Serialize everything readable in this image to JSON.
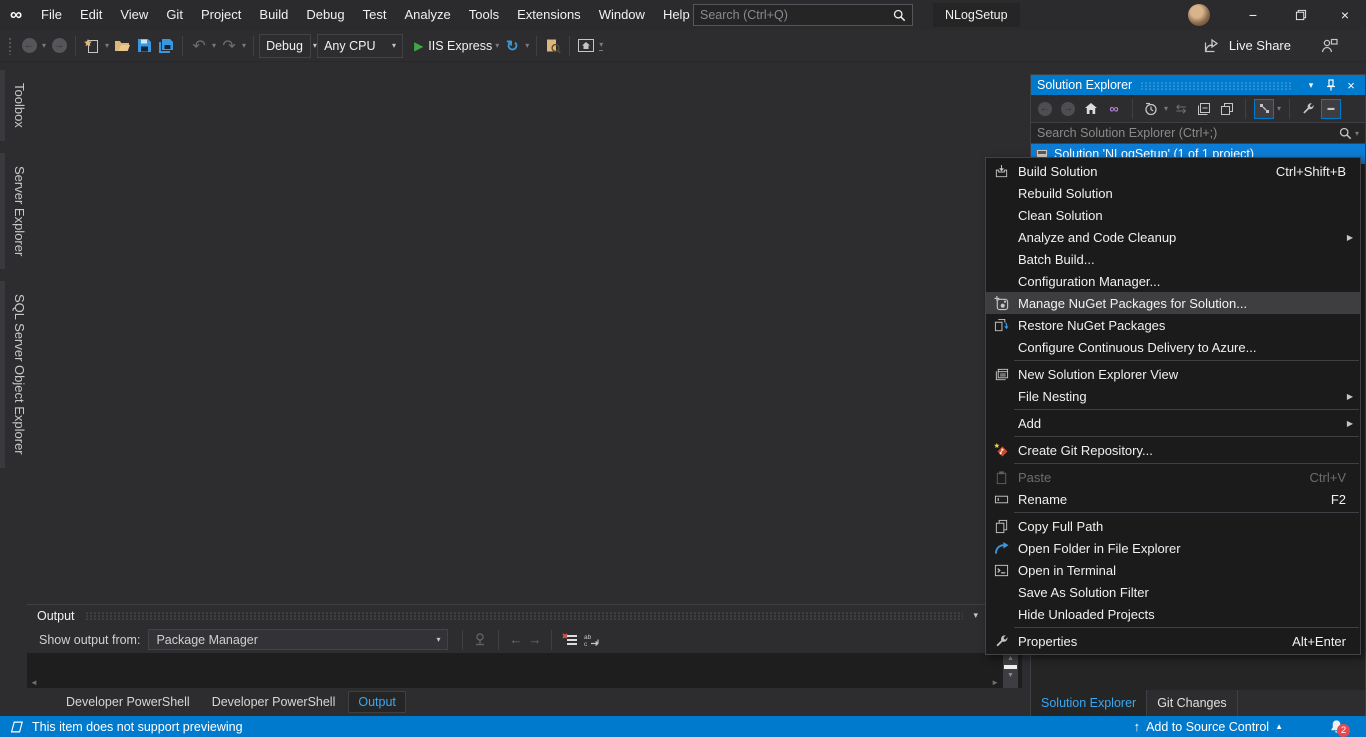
{
  "icons": {
    "caret_down": "▾",
    "caret_up": "▲",
    "submenu_arrow": "▶",
    "close": "×",
    "minimize": "−",
    "up_arrow": "↑",
    "undo": "↶",
    "redo": "↷",
    "refresh": "↻",
    "play": "▶",
    "sync": "⇆",
    "infinity": "∞",
    "back_arrow": "←",
    "forward_arrow": "→",
    "scroll_up": "▲",
    "scroll_down": "▼",
    "scroll_left": "◄",
    "scroll_right": "►",
    "preview_dash": "▬"
  },
  "titlebar": {
    "menus": [
      "File",
      "Edit",
      "View",
      "Git",
      "Project",
      "Build",
      "Debug",
      "Test",
      "Analyze",
      "Tools",
      "Extensions",
      "Window",
      "Help"
    ],
    "search_placeholder": "Search (Ctrl+Q)",
    "window_title": "NLogSetup"
  },
  "toolbar": {
    "configuration": "Debug",
    "platform": "Any CPU",
    "run_target": "IIS Express",
    "live_share_label": "Live Share"
  },
  "left_tabs": [
    "Toolbox",
    "Server Explorer",
    "SQL Server Object Explorer"
  ],
  "solution_explorer": {
    "title": "Solution Explorer",
    "search_placeholder": "Search Solution Explorer (Ctrl+;)",
    "selected_item": "Solution 'NLogSetup' (1 of 1 project)",
    "bottom_tabs": [
      "Solution Explorer",
      "Git Changes"
    ],
    "active_bottom_tab": "Solution Explorer"
  },
  "context_menu": {
    "items": [
      {
        "label": "Build Solution",
        "shortcut": "Ctrl+Shift+B",
        "icon": "build-icon"
      },
      {
        "label": "Rebuild Solution"
      },
      {
        "label": "Clean Solution"
      },
      {
        "label": "Analyze and Code Cleanup",
        "submenu": true
      },
      {
        "label": "Batch Build..."
      },
      {
        "label": "Configuration Manager..."
      },
      {
        "label": "Manage NuGet Packages for Solution...",
        "icon": "nuget-icon",
        "highlighted": true
      },
      {
        "label": "Restore NuGet Packages",
        "icon": "restore-nuget-icon"
      },
      {
        "label": "Configure Continuous Delivery to Azure..."
      },
      {
        "label": "New Solution Explorer View",
        "icon": "new-solution-explorer-view-icon"
      },
      {
        "label": "File Nesting",
        "submenu": true
      },
      {
        "label": "Add",
        "submenu": true
      },
      {
        "label": "Create Git Repository...",
        "icon": "create-git-repository-icon"
      },
      {
        "label": "Paste",
        "shortcut": "Ctrl+V",
        "icon": "paste-icon",
        "disabled": true
      },
      {
        "label": "Rename",
        "shortcut": "F2",
        "icon": "rename-icon"
      },
      {
        "label": "Copy Full Path",
        "icon": "copy-full-path-icon"
      },
      {
        "label": "Open Folder in File Explorer",
        "icon": "open-folder-icon"
      },
      {
        "label": "Open in Terminal",
        "icon": "terminal-icon"
      },
      {
        "label": "Save As Solution Filter"
      },
      {
        "label": "Hide Unloaded Projects"
      },
      {
        "label": "Properties",
        "shortcut": "Alt+Enter",
        "icon": "properties-icon"
      }
    ]
  },
  "output_panel": {
    "title": "Output",
    "show_output_from_label": "Show output from:",
    "selected_source": "Package Manager",
    "tabs": [
      "Developer PowerShell",
      "Developer PowerShell",
      "Output"
    ],
    "active_tab": "Output"
  },
  "status_bar": {
    "message": "This item does not support previewing",
    "source_control_label": "Add to Source Control",
    "notification_count": "2"
  },
  "colors": {
    "accent": "#007acc",
    "selection": "#0c7cd4",
    "menu_highlight": "#3e3e40"
  }
}
